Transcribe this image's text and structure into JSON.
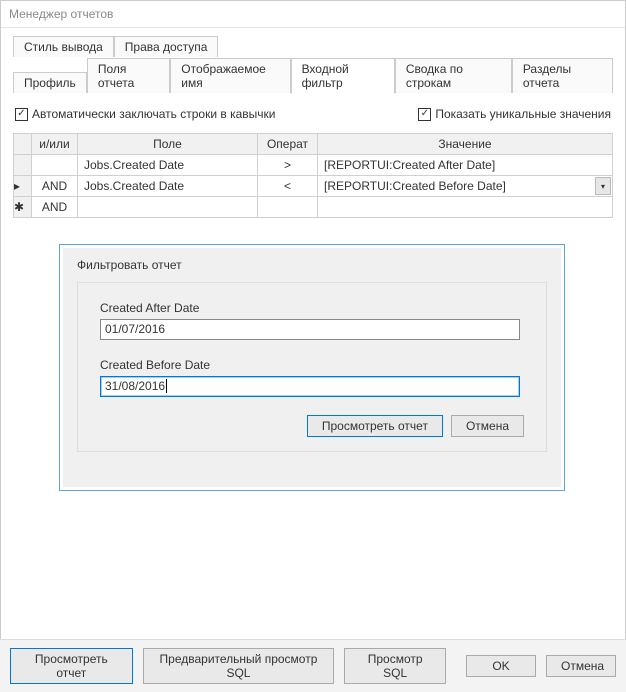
{
  "window": {
    "title": "Менеджер отчетов"
  },
  "tabs": {
    "row1": [
      {
        "label": "Стиль вывода"
      },
      {
        "label": "Права доступа"
      }
    ],
    "row2": [
      {
        "label": "Профиль"
      },
      {
        "label": "Поля отчета"
      },
      {
        "label": "Отображаемое имя"
      },
      {
        "label": "Входной фильтр"
      },
      {
        "label": "Сводка по строкам"
      },
      {
        "label": "Разделы отчета"
      }
    ],
    "active_row2_index": 3
  },
  "checks": {
    "auto_quote_label": "Автоматически заключать строки в кавычки",
    "show_unique_label": "Показать уникальные значения",
    "auto_quote_checked": true,
    "show_unique_checked": true
  },
  "grid": {
    "headers": {
      "andor": "и/или",
      "field": "Поле",
      "operator": "Операт",
      "value": "Значение"
    },
    "rows": [
      {
        "marker": "",
        "andor": "",
        "field": "Jobs.Created Date",
        "operator": ">",
        "value": "[REPORTUI:Created After Date]",
        "dropdown": false
      },
      {
        "marker": "▸",
        "andor": "AND",
        "field": "Jobs.Created Date",
        "operator": "<",
        "value": "[REPORTUI:Created Before Date]",
        "dropdown": true
      },
      {
        "marker": "✱",
        "andor": "AND",
        "field": "",
        "operator": "",
        "value": "",
        "dropdown": false
      }
    ]
  },
  "modal": {
    "title": "Фильтровать отчет",
    "fields": [
      {
        "label": "Created After Date",
        "value": "01/07/2016",
        "focused": false
      },
      {
        "label": "Created Before Date",
        "value": "31/08/2016",
        "focused": true
      }
    ],
    "buttons": {
      "view": "Просмотреть отчет",
      "cancel": "Отмена"
    }
  },
  "footer": {
    "view_report": "Просмотреть отчет",
    "preview_sql": "Предварительный просмотр SQL",
    "view_sql": "Просмотр SQL",
    "ok": "OK",
    "cancel": "Отмена"
  }
}
